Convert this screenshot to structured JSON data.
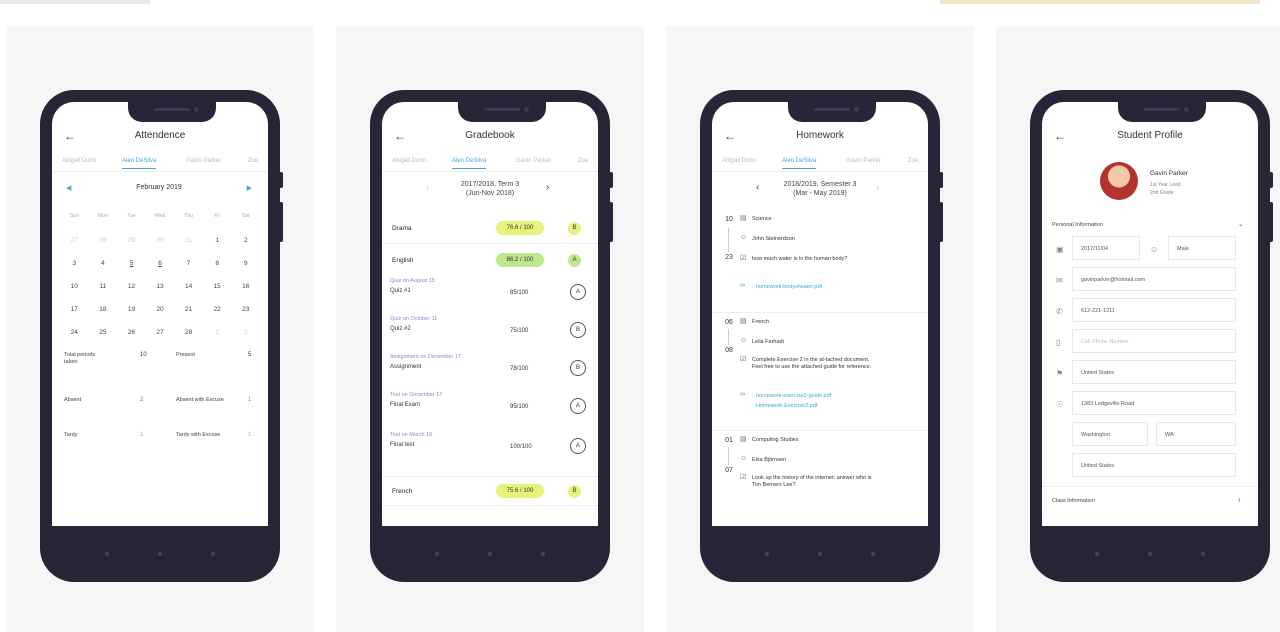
{
  "attendance": {
    "title": "Attendence",
    "tabs": [
      "Abigail Dunn",
      "Alen DeSilva",
      "Gavin Parker",
      "Zoe"
    ],
    "month": "February 2019",
    "weekdays": [
      "Sun",
      "Mon",
      "Tue",
      "Wed",
      "Thu",
      "Fri",
      "Sat"
    ],
    "weeks": [
      [
        "27",
        "28",
        "29",
        "30",
        "31",
        "1",
        "2"
      ],
      [
        "3",
        "4",
        "5",
        "6",
        "7",
        "8",
        "9"
      ],
      [
        "10",
        "11",
        "12",
        "13",
        "14",
        "15",
        "16"
      ],
      [
        "17",
        "18",
        "19",
        "20",
        "21",
        "22",
        "23"
      ],
      [
        "24",
        "25",
        "26",
        "27",
        "28",
        "1",
        "2"
      ]
    ],
    "total_label": "Total periods taken",
    "total_value": "10",
    "present_label": "Present",
    "present_value": "5",
    "absent_label": "Absent",
    "absent_value": "2",
    "absent_excuse_label": "Absent with Excuse",
    "absent_excuse_value": "1",
    "tardy_label": "Tardy",
    "tardy_value": "1",
    "tardy_excuse_label": "Tardy with Excuse",
    "tardy_excuse_value": "1"
  },
  "gradebook": {
    "title": "Gradebook",
    "tabs": [
      "Abigail Dunn",
      "Alen DeSilva",
      "Gavin Parker",
      "Zoe"
    ],
    "term_line1": "2017/2018, Term 3",
    "term_line2": "(Jun-Nov 2018)",
    "drama_name": "Drama",
    "drama_score": "76.6 / 100",
    "drama_grade": "B",
    "english_name": "English",
    "english_score": "86.2 / 100",
    "english_grade": "A",
    "assignments": [
      {
        "heading": "Quiz on August 15",
        "title": "Quiz #1",
        "score": "85/100",
        "grade": "A"
      },
      {
        "heading": "Quiz on October 11",
        "title": "Quiz #2",
        "score": "75/100",
        "grade": "B"
      },
      {
        "heading": "Assignment on December 17",
        "title": "Assignment",
        "score": "78/100",
        "grade": "B"
      },
      {
        "heading": "Test on December 17",
        "title": "Final Exam",
        "score": "95/100",
        "grade": "A"
      },
      {
        "heading": "Test on March 19",
        "title": "Final test",
        "score": "100/100",
        "grade": "A"
      }
    ],
    "french_name": "French",
    "french_score": "75.6 / 100",
    "french_grade": "B"
  },
  "homework": {
    "title": "Homework",
    "tabs": [
      "Abigail Dunn",
      "Alen DeSilva",
      "Gavin Parker",
      "Zoe"
    ],
    "term_line1": "2018/2019, Semester 3",
    "term_line2": "(Mar - May 2019)",
    "items": [
      {
        "from": "10",
        "to": "23",
        "subject": "Science",
        "teacher": "John Steinerdson",
        "task": "how much water is in the human body?",
        "links": [
          "homework-bodyofwater.pdf"
        ]
      },
      {
        "from": "06",
        "to": "08",
        "subject": "French",
        "teacher": "Leila Farhadi",
        "task": "Complete Exercise 2 in the at-tached document. Feel free to use the attached guide for reference.",
        "links": [
          "homework-exercise2-guide.pdf",
          "Homework-Exercise2.pdf"
        ]
      },
      {
        "from": "01",
        "to": "07",
        "subject": "Computing Studies",
        "teacher": "Elsa Björnsen",
        "task": "Look up the history of the internet: answer who is Tim Berners Lee?",
        "links": []
      }
    ]
  },
  "profile": {
    "title": "Student Profile",
    "name": "Gavin Parker",
    "line1": "1st Year Lead",
    "line2": "2nd Grade",
    "section_personal": "Personal Information",
    "birthdate": "2017/11/04",
    "gender": "Male",
    "email": "gavinparker@hotmail.com",
    "phone": "612-221-1211",
    "cell_placeholder": "Cell Phone Number",
    "nationality": "United States",
    "address": "1383 Lodgeville Road",
    "city": "Washington",
    "state": "WA",
    "country": "United States",
    "section_class": "Class Information"
  }
}
